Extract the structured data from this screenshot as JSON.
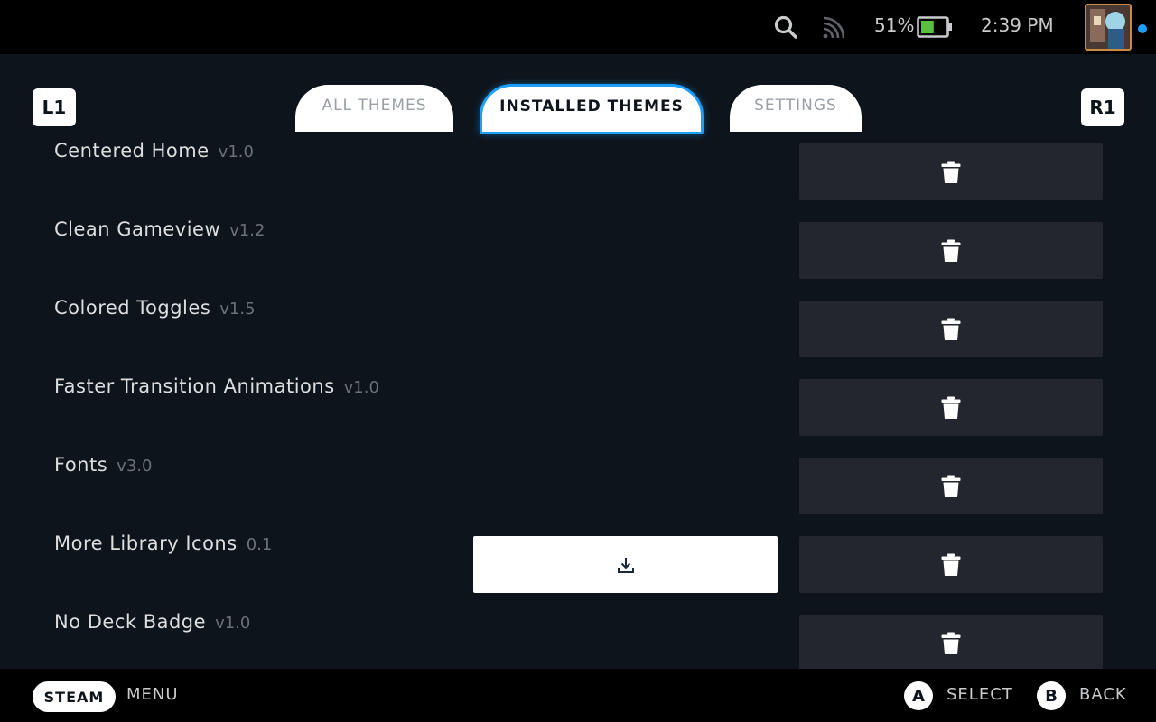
{
  "status": {
    "battery_percent": "51%",
    "battery_level": 0.51,
    "time": "2:39 PM",
    "icons": [
      "search-icon",
      "cast-icon",
      "battery-icon"
    ],
    "notification_color": "#1a9fff"
  },
  "shoulders": {
    "left": "L1",
    "right": "R1"
  },
  "tabs": [
    {
      "label": "ALL THEMES",
      "active": false
    },
    {
      "label": "INSTALLED THEMES",
      "active": true
    },
    {
      "label": "SETTINGS",
      "active": false
    }
  ],
  "themes": [
    {
      "name": "Centered Home",
      "version": "v1.0",
      "has_update": false
    },
    {
      "name": "Clean Gameview",
      "version": "v1.2",
      "has_update": false
    },
    {
      "name": "Colored Toggles",
      "version": "v1.5",
      "has_update": false
    },
    {
      "name": "Faster Transition Animations",
      "version": "v1.0",
      "has_update": false
    },
    {
      "name": "Fonts",
      "version": "v3.0",
      "has_update": false
    },
    {
      "name": "More Library Icons",
      "version": "0.1",
      "has_update": true
    },
    {
      "name": "No Deck Badge",
      "version": "v1.0",
      "has_update": false
    }
  ],
  "bottom": {
    "steam": "STEAM",
    "menu": "MENU",
    "a_glyph": "A",
    "select": "SELECT",
    "b_glyph": "B",
    "back": "BACK"
  },
  "colors": {
    "accent": "#1a9fff",
    "background": "#0e141b",
    "button_dark": "#23262e",
    "battery_fill": "#59bf40"
  }
}
